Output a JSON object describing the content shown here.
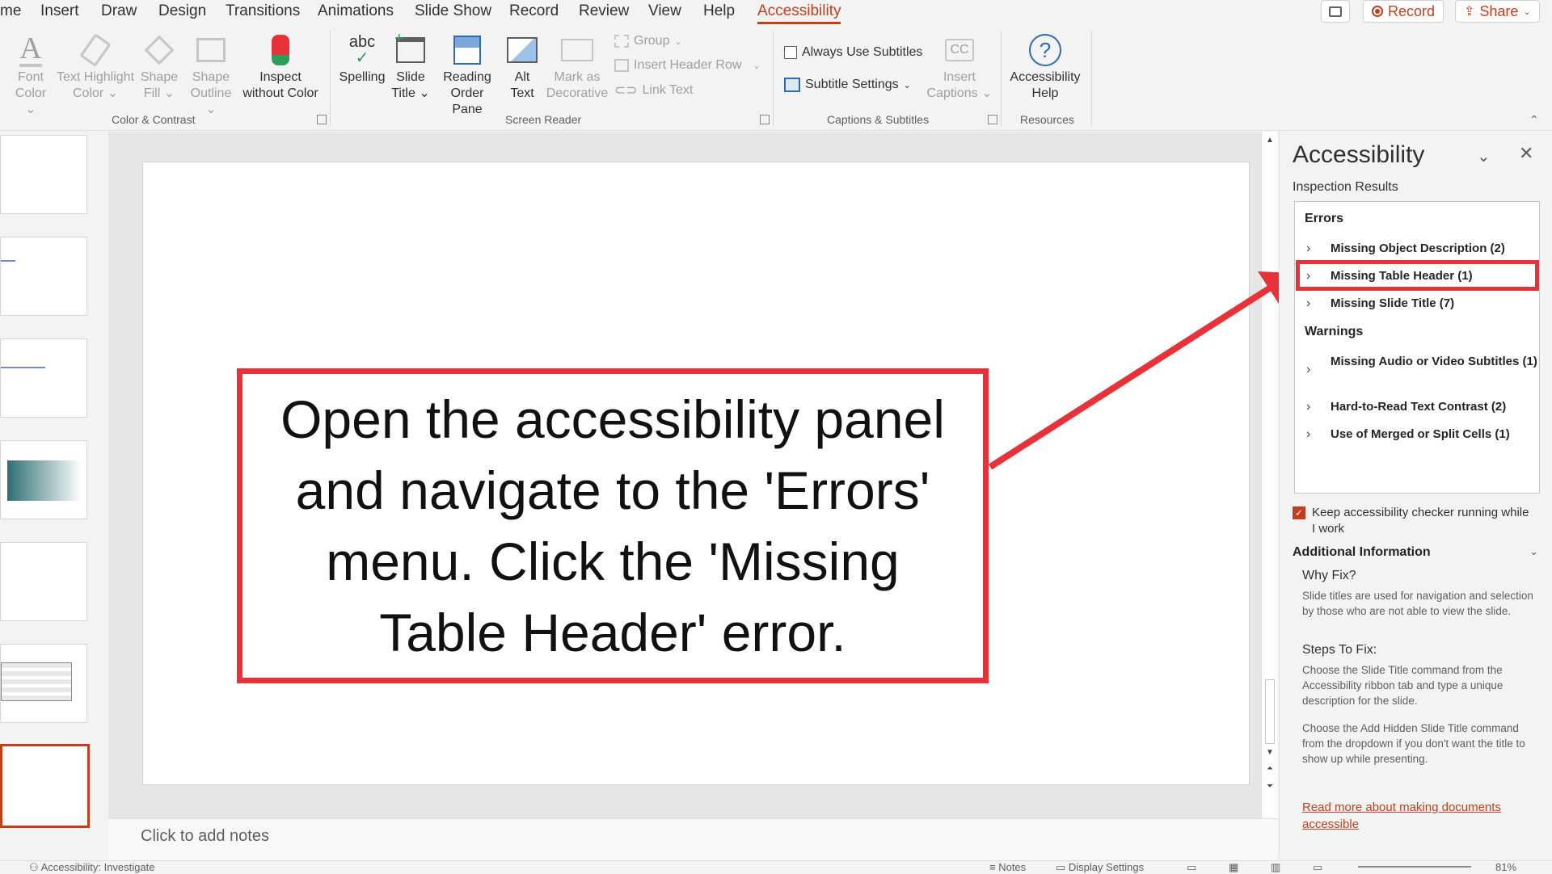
{
  "menu": {
    "tabs": [
      {
        "label": "me"
      },
      {
        "label": "Insert"
      },
      {
        "label": "Draw"
      },
      {
        "label": "Design"
      },
      {
        "label": "Transitions"
      },
      {
        "label": "Animations"
      },
      {
        "label": "Slide Show"
      },
      {
        "label": "Record"
      },
      {
        "label": "Review"
      },
      {
        "label": "View"
      },
      {
        "label": "Help"
      },
      {
        "label": "Accessibility"
      }
    ],
    "active_tab": "Accessibility",
    "record_label": "Record",
    "share_label": "Share"
  },
  "ribbon": {
    "color_contrast": {
      "label": "Color & Contrast",
      "font_color": [
        "Font",
        "Color"
      ],
      "text_highlight": [
        "Text Highlight",
        "Color"
      ],
      "shape_fill": [
        "Shape",
        "Fill"
      ],
      "shape_outline": [
        "Shape",
        "Outline"
      ],
      "inspect": [
        "Inspect",
        "without Color"
      ]
    },
    "screen_reader": {
      "label": "Screen Reader",
      "spelling": "Spelling",
      "slide_title": [
        "Slide",
        "Title"
      ],
      "reading_order": [
        "Reading",
        "Order Pane"
      ],
      "alt_text": [
        "Alt",
        "Text"
      ],
      "mark_decorative": [
        "Mark as",
        "Decorative"
      ],
      "group": "Group",
      "insert_header_row": "Insert Header Row",
      "link_text": "Link Text"
    },
    "captions": {
      "label": "Captions & Subtitles",
      "always_use_subtitles": "Always Use Subtitles",
      "subtitle_settings": "Subtitle Settings",
      "insert_captions": [
        "Insert",
        "Captions"
      ]
    },
    "resources": {
      "label": "Resources",
      "accessibility_help": [
        "Accessibility",
        "Help"
      ]
    }
  },
  "slide": {
    "callout_text": "Open the accessibility panel and navigate to the 'Errors' menu. Click the 'Missing Table Header' error.",
    "notes_placeholder": "Click to add notes"
  },
  "pane": {
    "title": "Accessibility",
    "subtitle": "Inspection Results",
    "errors_heading": "Errors",
    "errors": [
      {
        "label": "Missing Object Description (2)"
      },
      {
        "label": "Missing Table Header (1)"
      },
      {
        "label": "Missing Slide Title (7)"
      }
    ],
    "warnings_heading": "Warnings",
    "warnings": [
      {
        "label": "Missing Audio or Video Subtitles (1)"
      },
      {
        "label": "Hard-to-Read Text Contrast (2)"
      },
      {
        "label": "Use of Merged or Split Cells (1)"
      }
    ],
    "keep_running": "Keep accessibility checker running while I work",
    "keep_running_checked": true,
    "additional_info": "Additional Information",
    "why_fix_heading": "Why Fix?",
    "why_fix_text": "Slide titles are used for navigation and selection by those who are not able to view the slide.",
    "steps_heading": "Steps To Fix:",
    "steps_text_1": "Choose the Slide Title command from the Accessibility ribbon tab and type a unique description for the slide.",
    "steps_text_2": "Choose the Add Hidden Slide Title command from the dropdown if you don't want the title to show up while presenting.",
    "read_more": "Read more about making documents accessible"
  },
  "status": {
    "accessibility": "Accessibility: Investigate",
    "notes": "Notes",
    "display_settings": "Display Settings",
    "zoom": "81%"
  },
  "colors": {
    "accent": "#c43e1c",
    "callout_border": "#e8323a",
    "link": "#c43e1c"
  }
}
